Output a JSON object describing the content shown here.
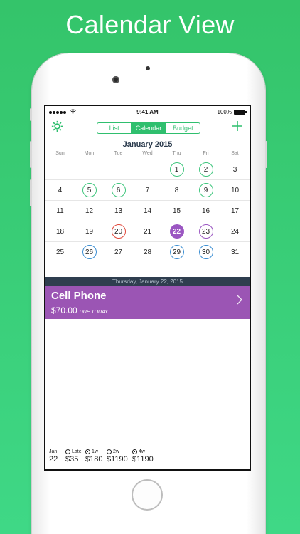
{
  "headline": "Calendar View",
  "status_bar": {
    "time": "9:41 AM",
    "battery": "100%"
  },
  "nav": {
    "segments": [
      "List",
      "Calendar",
      "Budget"
    ],
    "active_segment": "Calendar",
    "gear_icon": "gear-icon",
    "add_icon": "plus-icon"
  },
  "calendar": {
    "month": "January 2015",
    "weekdays": [
      "Sun",
      "Mon",
      "Tue",
      "Wed",
      "Thu",
      "Fri",
      "Sat"
    ],
    "weeks": [
      [
        {
          "day": ""
        },
        {
          "day": ""
        },
        {
          "day": ""
        },
        {
          "day": ""
        },
        {
          "day": "1",
          "ring": "green"
        },
        {
          "day": "2",
          "ring": "green"
        },
        {
          "day": "3"
        }
      ],
      [
        {
          "day": "4"
        },
        {
          "day": "5",
          "ring": "green"
        },
        {
          "day": "6",
          "ring": "green"
        },
        {
          "day": "7"
        },
        {
          "day": "8"
        },
        {
          "day": "9",
          "ring": "green"
        },
        {
          "day": "10"
        }
      ],
      [
        {
          "day": "11"
        },
        {
          "day": "12"
        },
        {
          "day": "13"
        },
        {
          "day": "14"
        },
        {
          "day": "15"
        },
        {
          "day": "16"
        },
        {
          "day": "17"
        }
      ],
      [
        {
          "day": "18"
        },
        {
          "day": "19"
        },
        {
          "day": "20",
          "ring": "red"
        },
        {
          "day": "21"
        },
        {
          "day": "22",
          "ring": "selected"
        },
        {
          "day": "23",
          "ring": "purple"
        },
        {
          "day": "24"
        }
      ],
      [
        {
          "day": "25"
        },
        {
          "day": "26",
          "ring": "blue"
        },
        {
          "day": "27"
        },
        {
          "day": "28"
        },
        {
          "day": "29",
          "ring": "blue"
        },
        {
          "day": "30",
          "ring": "blue"
        },
        {
          "day": "31"
        }
      ]
    ],
    "ring_colors": {
      "green": "#3fc67d",
      "red": "#e0483b",
      "blue": "#3d8fd3",
      "purple": "#9b57c2"
    }
  },
  "selected_date": "Thursday, January 22, 2015",
  "bill": {
    "name": "Cell Phone",
    "amount": "$70.00",
    "due_label": "DUE TODAY",
    "color": "#9b55b4"
  },
  "footer": {
    "date_month": "Jan",
    "date_day": "22",
    "items": [
      {
        "label": "Late",
        "value": "$35"
      },
      {
        "label": "1w",
        "value": "$180"
      },
      {
        "label": "2w",
        "value": "$1190"
      },
      {
        "label": "4w",
        "value": "$1190"
      }
    ]
  }
}
